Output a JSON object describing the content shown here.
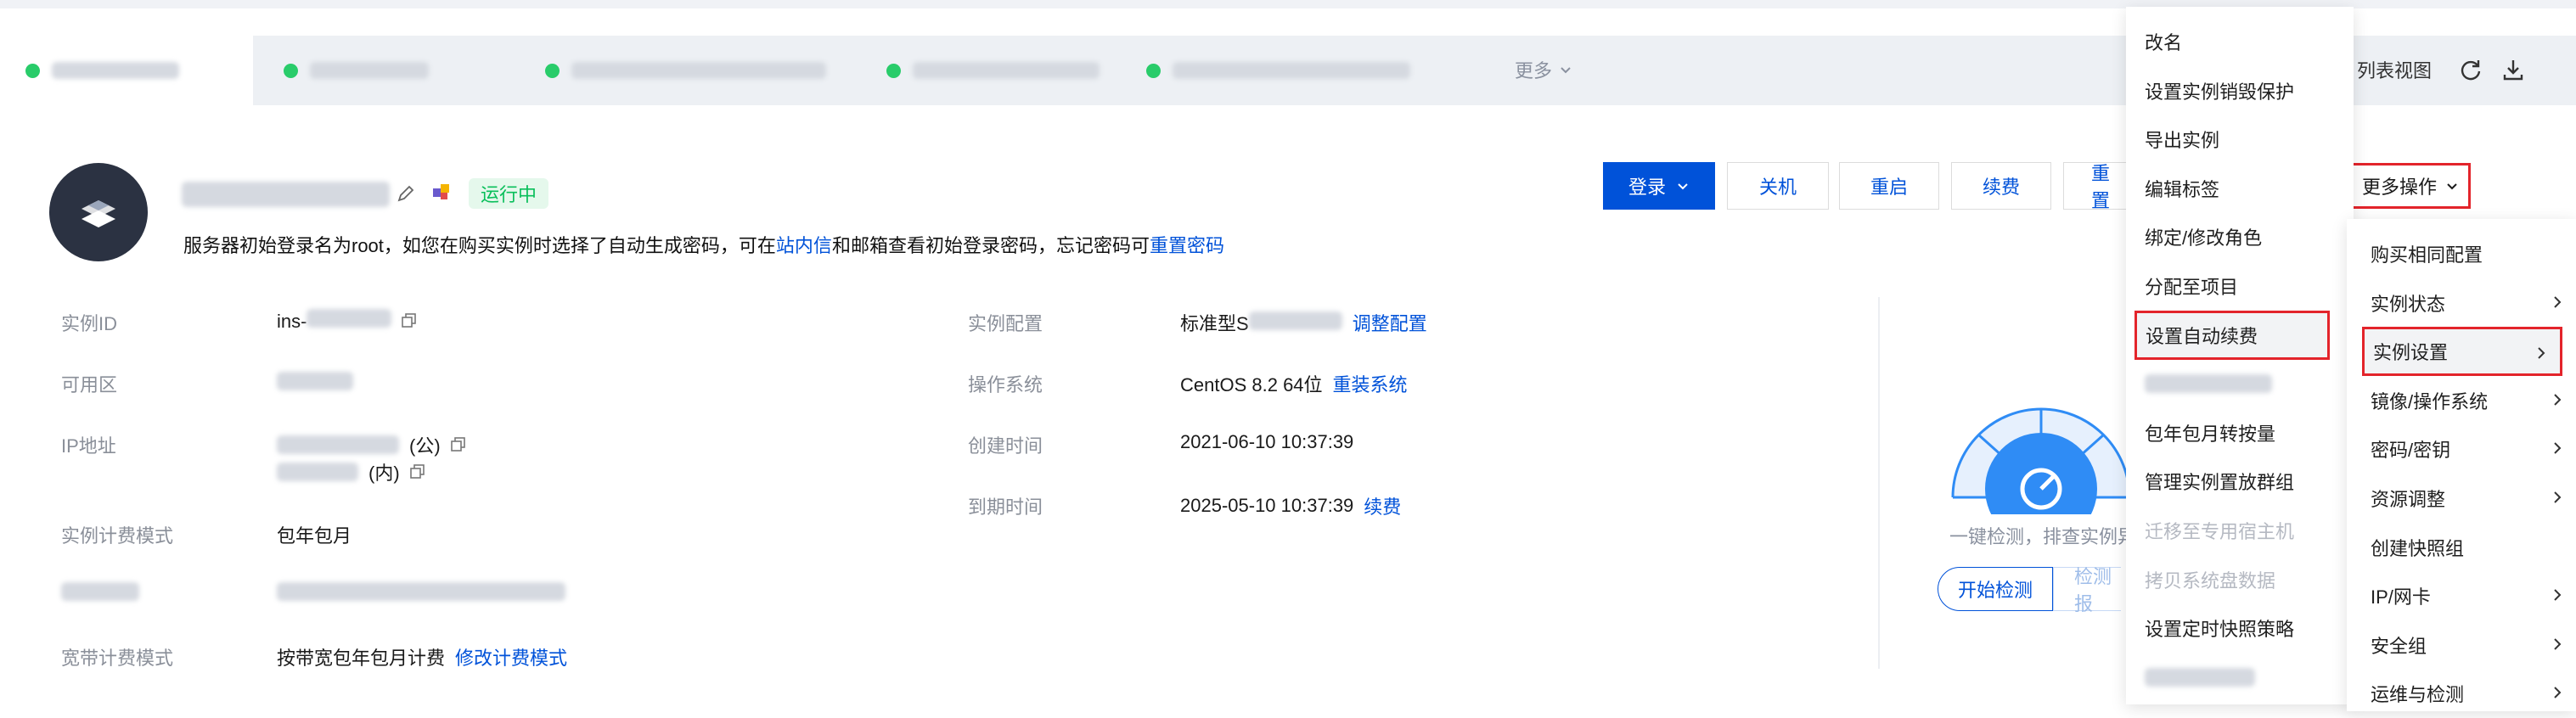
{
  "tabs": {
    "more_label": "更多",
    "list_view_label": "列表视图"
  },
  "header": {
    "status": "运行中",
    "notice_prefix": "服务器初始登录名为root，如您在购买实例时选择了自动生成密码，可在",
    "notice_link1": "站内信",
    "notice_middle": "和邮箱查看初始登录密码，忘记密码可",
    "notice_link2": "重置密码"
  },
  "actions": {
    "login": "登录",
    "shutdown": "关机",
    "restart": "重启",
    "renew": "续费",
    "reset_partial": "重置",
    "more_ops": "更多操作"
  },
  "info": {
    "instance_id_label": "实例ID",
    "instance_id_prefix": "ins-",
    "zone_label": "可用区",
    "ip_label": "IP地址",
    "ip_public_suffix": "(公)",
    "ip_private_suffix": "(内)",
    "billing_label": "实例计费模式",
    "billing_value": "包年包月",
    "bandwidth_label": "宽带计费模式",
    "bandwidth_value": "按带宽包年包月计费",
    "bandwidth_link": "修改计费模式",
    "config_label": "实例配置",
    "config_value_prefix": "标准型S",
    "config_link": "调整配置",
    "os_label": "操作系统",
    "os_value": "CentOS 8.2 64位",
    "os_link": "重装系统",
    "created_label": "创建时间",
    "created_value": "2021-06-10 10:37:39",
    "expire_label": "到期时间",
    "expire_value": "2025-05-10 10:37:39",
    "expire_link": "续费"
  },
  "gauge": {
    "text": "一键检测，排查实例异",
    "start_btn": "开始检测",
    "report_btn": "检测报"
  },
  "submenu": [
    {
      "label": "改名",
      "disabled": false
    },
    {
      "label": "设置实例销毁保护",
      "disabled": false
    },
    {
      "label": "导出实例",
      "disabled": false
    },
    {
      "label": "编辑标签",
      "disabled": false
    },
    {
      "label": "绑定/修改角色",
      "disabled": false
    },
    {
      "label": "分配至项目",
      "disabled": false
    },
    {
      "label": "设置自动续费",
      "disabled": false
    },
    {
      "label": "",
      "disabled": false
    },
    {
      "label": "包年包月转按量",
      "disabled": false
    },
    {
      "label": "管理实例置放群组",
      "disabled": false
    },
    {
      "label": "迁移至专用宿主机",
      "disabled": true
    },
    {
      "label": "拷贝系统盘数据",
      "disabled": true
    },
    {
      "label": "设置定时快照策略",
      "disabled": false
    },
    {
      "label": "",
      "disabled": false
    }
  ],
  "more_menu": [
    {
      "label": "购买相同配置",
      "has_sub": false
    },
    {
      "label": "实例状态",
      "has_sub": true
    },
    {
      "label": "实例设置",
      "has_sub": true
    },
    {
      "label": "镜像/操作系统",
      "has_sub": true
    },
    {
      "label": "密码/密钥",
      "has_sub": true
    },
    {
      "label": "资源调整",
      "has_sub": true
    },
    {
      "label": "创建快照组",
      "has_sub": false
    },
    {
      "label": "IP/网卡",
      "has_sub": true
    },
    {
      "label": "安全组",
      "has_sub": true
    },
    {
      "label": "运维与检测",
      "has_sub": true
    }
  ],
  "colors": {
    "primary": "#0052d9",
    "running": "#29cc6a",
    "highlight_border": "#e3242b",
    "gauge": "#2f8cf5"
  }
}
